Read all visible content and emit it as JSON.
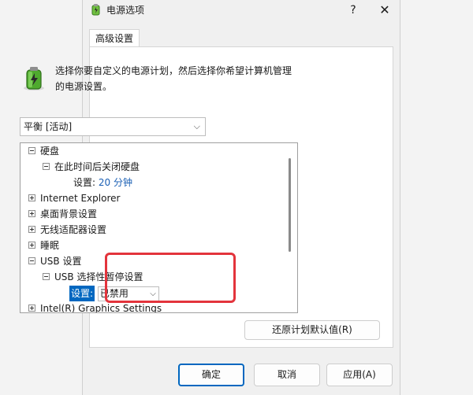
{
  "window": {
    "title": "电源选项",
    "help": "?",
    "close": "✕"
  },
  "tabs": [
    {
      "label": "高级设置"
    }
  ],
  "intro": "选择你要自定义的电源计划，然后选择你希望计算机管理的电源设置。",
  "plan": {
    "selected": "平衡 [活动]"
  },
  "tree": {
    "hard_disk": "硬盘",
    "turn_off_disk": "在此时间后关闭硬盘",
    "setting_label": "设置:",
    "setting_value": "20 分钟",
    "ie": "Internet Explorer",
    "desktop_bg": "桌面背景设置",
    "wireless": "无线适配器设置",
    "sleep": "睡眠",
    "usb": "USB 设置",
    "usb_suspend": "USB 选择性暂停设置",
    "usb_setting_label": "设置:",
    "usb_setting_value": "已禁用",
    "intel_graphics": "Intel(R) Graphics Settings"
  },
  "buttons": {
    "restore": "还原计划默认值(R)",
    "ok": "确定",
    "cancel": "取消",
    "apply": "应用(A)"
  },
  "colors": {
    "accent": "#0067c0",
    "highlight": "#e3343c",
    "value_text": "#1a5fb4"
  }
}
